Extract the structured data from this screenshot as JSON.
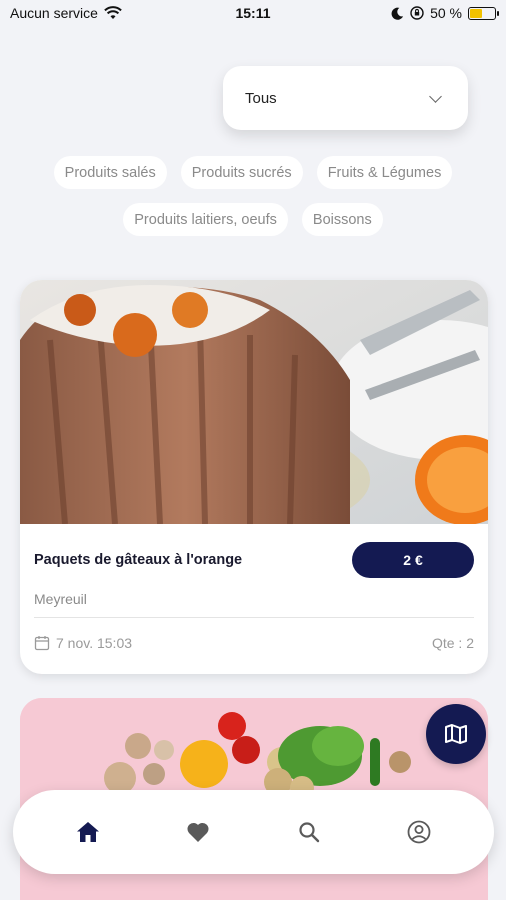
{
  "status_bar": {
    "carrier": "Aucun service",
    "time": "15:11",
    "battery_text": "50 %",
    "battery_level": 0.5
  },
  "filter": {
    "selected": "Tous"
  },
  "categories": [
    "Produits salés",
    "Produits sucrés",
    "Fruits & Légumes",
    "Produits laitiers, oeufs",
    "Boissons"
  ],
  "listing": {
    "title": "Paquets de gâteaux à l'orange",
    "price": "2 €",
    "location": "Meyreuil",
    "date": "7 nov. 15:03",
    "quantity": "Qte : 2"
  },
  "nav": {
    "items": [
      "home-icon",
      "heart-icon",
      "search-icon",
      "profile-icon"
    ],
    "active": "home-icon"
  },
  "colors": {
    "accent": "#141a52",
    "background": "#f2f3f7",
    "chip_text": "#8a8a8a",
    "battery": "#f2c200"
  }
}
